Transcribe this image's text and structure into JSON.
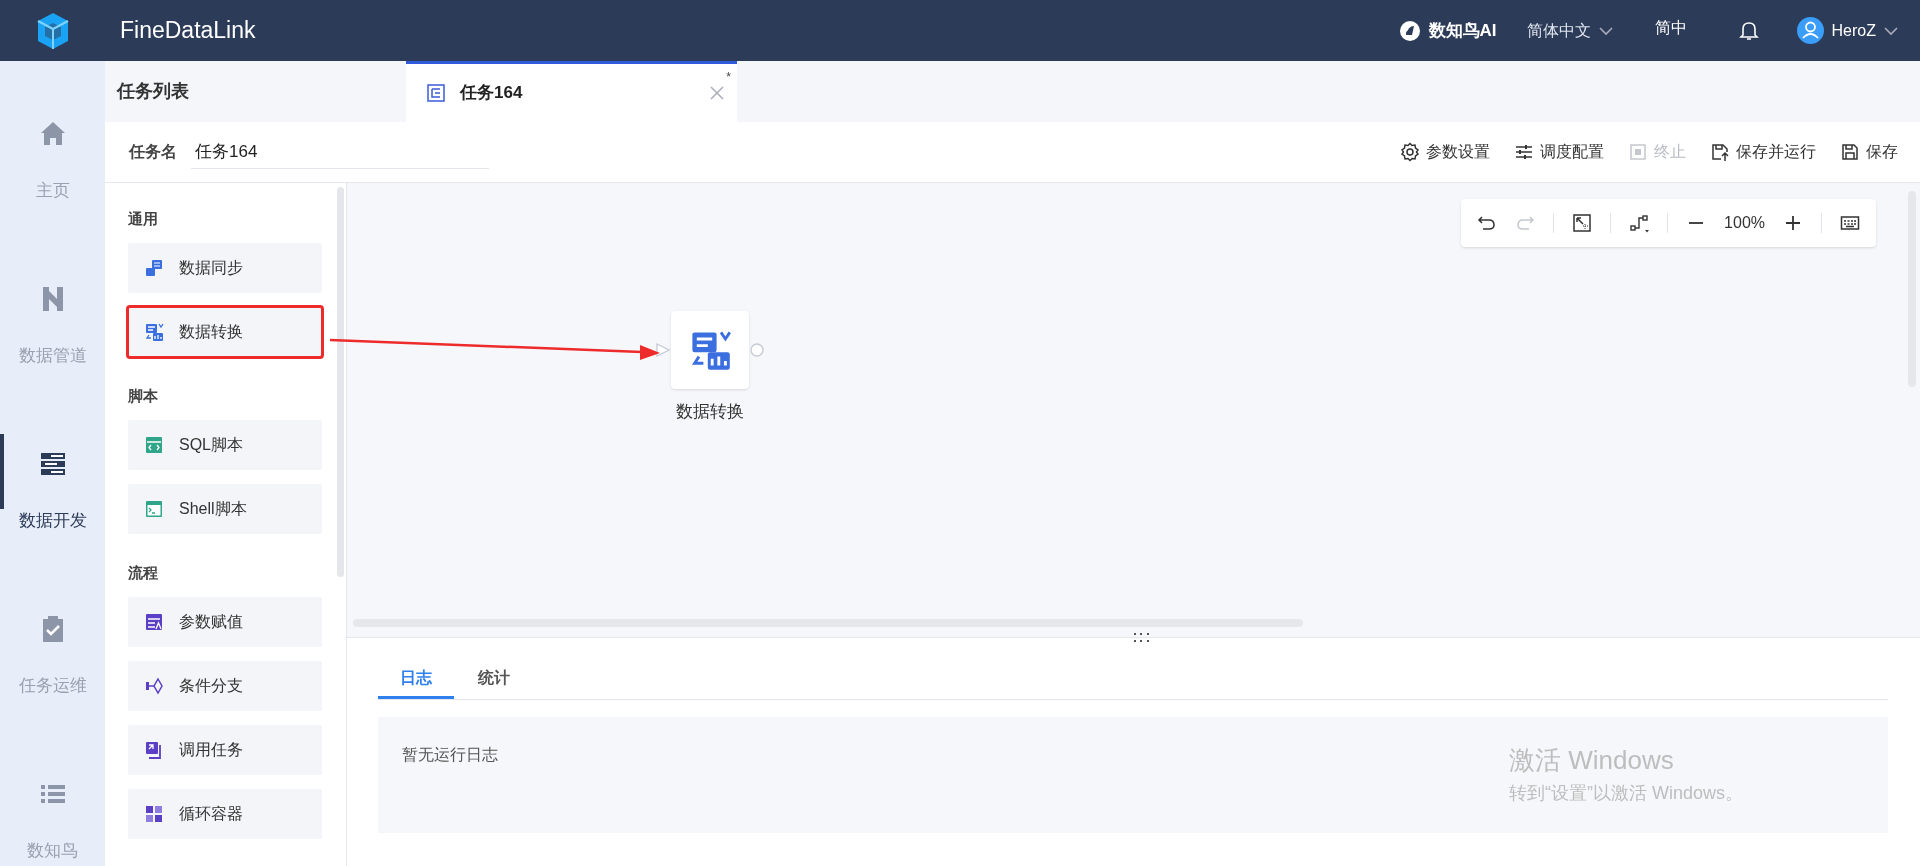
{
  "top_bar": {
    "app_name": "FineDataLink",
    "ai_label": "数知鸟AI",
    "language": "简体中文",
    "lang_short": "简中",
    "user": "HeroZ"
  },
  "nav": [
    {
      "label": "主页",
      "kind": "home",
      "selected": false
    },
    {
      "label": "数据管道",
      "kind": "pipe",
      "selected": false
    },
    {
      "label": "数据开发",
      "kind": "dev",
      "selected": true
    },
    {
      "label": "任务运维",
      "kind": "clipboard",
      "selected": false
    },
    {
      "label": "数知鸟",
      "kind": "list",
      "selected": false
    }
  ],
  "task_list_title": "任务列表",
  "tabs": [
    {
      "label": "任务164",
      "selected": true,
      "modified_mark": "*"
    }
  ],
  "task_name": {
    "label": "任务名",
    "value": "任务164"
  },
  "actions": [
    {
      "label": "参数设置",
      "kind": "gear",
      "disabled": false
    },
    {
      "label": "调度配置",
      "kind": "sliders",
      "disabled": false
    },
    {
      "label": "终止",
      "kind": "stop",
      "disabled": true
    },
    {
      "label": "保存并运行",
      "kind": "saverun",
      "disabled": false
    },
    {
      "label": "保存",
      "kind": "save",
      "disabled": false
    }
  ],
  "palette": [
    {
      "heading": "通用",
      "items": [
        {
          "label": "数据同步",
          "kind": "sync",
          "highlighted": false
        },
        {
          "label": "数据转换",
          "kind": "transform",
          "highlighted": true
        }
      ]
    },
    {
      "heading": "脚本",
      "items": [
        {
          "label": "SQL脚本",
          "kind": "sql",
          "highlighted": false
        },
        {
          "label": "Shell脚本",
          "kind": "shell",
          "highlighted": false
        }
      ]
    },
    {
      "heading": "流程",
      "items": [
        {
          "label": "参数赋值",
          "kind": "param",
          "highlighted": false
        },
        {
          "label": "条件分支",
          "kind": "branch",
          "highlighted": false
        },
        {
          "label": "调用任务",
          "kind": "call",
          "highlighted": false
        },
        {
          "label": "循环容器",
          "kind": "loop",
          "highlighted": false
        }
      ]
    }
  ],
  "canvas_toolbar": {
    "tools": [
      {
        "kind": "undo",
        "disabled": false
      },
      {
        "kind": "redo",
        "disabled": true
      },
      {
        "kind": "fit",
        "disabled": false
      },
      {
        "kind": "layout",
        "disabled": false
      },
      {
        "kind": "zoom_out",
        "disabled": false
      },
      {
        "kind": "zoom_level",
        "text": "100%"
      },
      {
        "kind": "zoom_in",
        "disabled": false
      },
      {
        "kind": "keyboard",
        "disabled": false
      }
    ]
  },
  "canvas": {
    "nodes": [
      {
        "label": "数据转换",
        "kind": "transform"
      }
    ]
  },
  "bottom_tabs": [
    {
      "label": "日志",
      "selected": true
    },
    {
      "label": "统计",
      "selected": false
    }
  ],
  "log_empty": "暂无运行日志",
  "activation": {
    "title": "激活 Windows",
    "subtitle": "转到“设置”以激活 Windows。"
  }
}
